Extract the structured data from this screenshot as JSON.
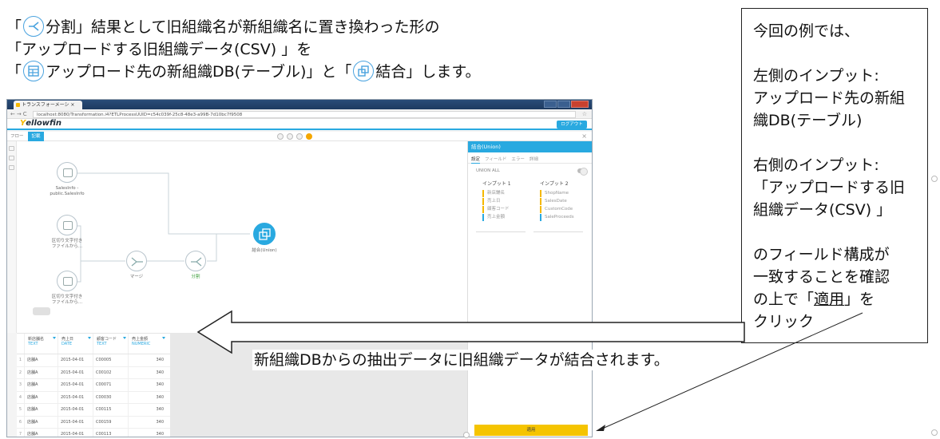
{
  "intro": {
    "line1_open": "「",
    "line1_rest": "分割」結果として旧組織名が新組織名に置き換わった形の",
    "line2": "「アップロードする旧組織データ(CSV) 」を",
    "line3_open": "「",
    "line3_mid": "アップロード先の新組織DB(テーブル)」と「",
    "line3_end": "結合」します。"
  },
  "callout": {
    "title": "今回の例では、",
    "left_label": "左側のインプット:",
    "left_value_1": "アップロード先の新組",
    "left_value_2": "織DB(テーブル)",
    "right_label": "右側のインプット:",
    "right_value_1": "「アップロードする旧",
    "right_value_2": "組織データ(CSV) 」",
    "confirm_1": "のフィールド構成が",
    "confirm_2": "一致することを確認",
    "confirm_3_pre": "の上で「",
    "confirm_3_link": "適用",
    "confirm_3_post": "」を",
    "confirm_4": "クリック"
  },
  "caption": "新組織DBからの抽出データに旧組織データが結合されます。",
  "browser": {
    "tab_title": "トランスフォーメーシ ×",
    "url": "localhost:8080/Transformation.i4?ETLProcessUUID=c54c039f-25c8-48e3-a99B-7d10bc7f9508",
    "logo_prefix": "Y",
    "logo_rest": "ellowfin",
    "logout": "ログアウト",
    "tab_flow": "フロー",
    "tab_active": "記載"
  },
  "flow": {
    "nodes": [
      {
        "id": "db",
        "label1": "SalesInfo -",
        "label2": "public.SalesInfo",
        "icon": "table-icon"
      },
      {
        "id": "csv1",
        "label1": "区切り文字付き",
        "label2": "ファイルから...",
        "icon": "file-icon"
      },
      {
        "id": "csv2",
        "label1": "区切り文字付き",
        "label2": "ファイルから...",
        "icon": "file-icon"
      },
      {
        "id": "merge",
        "label1": "マージ",
        "label2": "",
        "icon": "merge-icon"
      },
      {
        "id": "split",
        "label1": "分割",
        "label2": "",
        "icon": "split-icon"
      },
      {
        "id": "union",
        "label1": "結合(Union)",
        "label2": "",
        "icon": "union-icon"
      }
    ]
  },
  "panel": {
    "title": "結合(Union)",
    "tabs": [
      "設定",
      "フィールド",
      "エラー",
      "詳細"
    ],
    "union_all": "UNION ALL",
    "input1": {
      "title": "インプット 1",
      "fields": [
        "新店舗名",
        "売上日",
        "顧客コード",
        "売上金額"
      ]
    },
    "input2": {
      "title": "インプット 2",
      "fields": [
        "ShopName",
        "SalesDate",
        "CustomCode",
        "SaleProceeds"
      ]
    },
    "apply": "適用"
  },
  "table": {
    "columns": [
      {
        "name": "新店舗名",
        "type": "TEXT"
      },
      {
        "name": "売上日",
        "type": "DATE"
      },
      {
        "name": "顧客コード",
        "type": "TEXT"
      },
      {
        "name": "売上金額",
        "type": "NUMERIC"
      }
    ],
    "rows": [
      [
        "1",
        "店舗A",
        "2015-04-01",
        "C00005",
        "340"
      ],
      [
        "2",
        "店舗A",
        "2015-04-01",
        "C00102",
        "340"
      ],
      [
        "3",
        "店舗A",
        "2015-04-01",
        "C00071",
        "340"
      ],
      [
        "4",
        "店舗A",
        "2015-04-01",
        "C00030",
        "340"
      ],
      [
        "5",
        "店舗A",
        "2015-04-01",
        "C00115",
        "340"
      ],
      [
        "6",
        "店舗A",
        "2015-04-01",
        "C00159",
        "340"
      ],
      [
        "7",
        "店舗A",
        "2015-04-01",
        "C00113",
        "340"
      ]
    ]
  },
  "colors": {
    "accent": "#29a9e0",
    "apply": "#f5c400",
    "brand": "#f5b800"
  }
}
